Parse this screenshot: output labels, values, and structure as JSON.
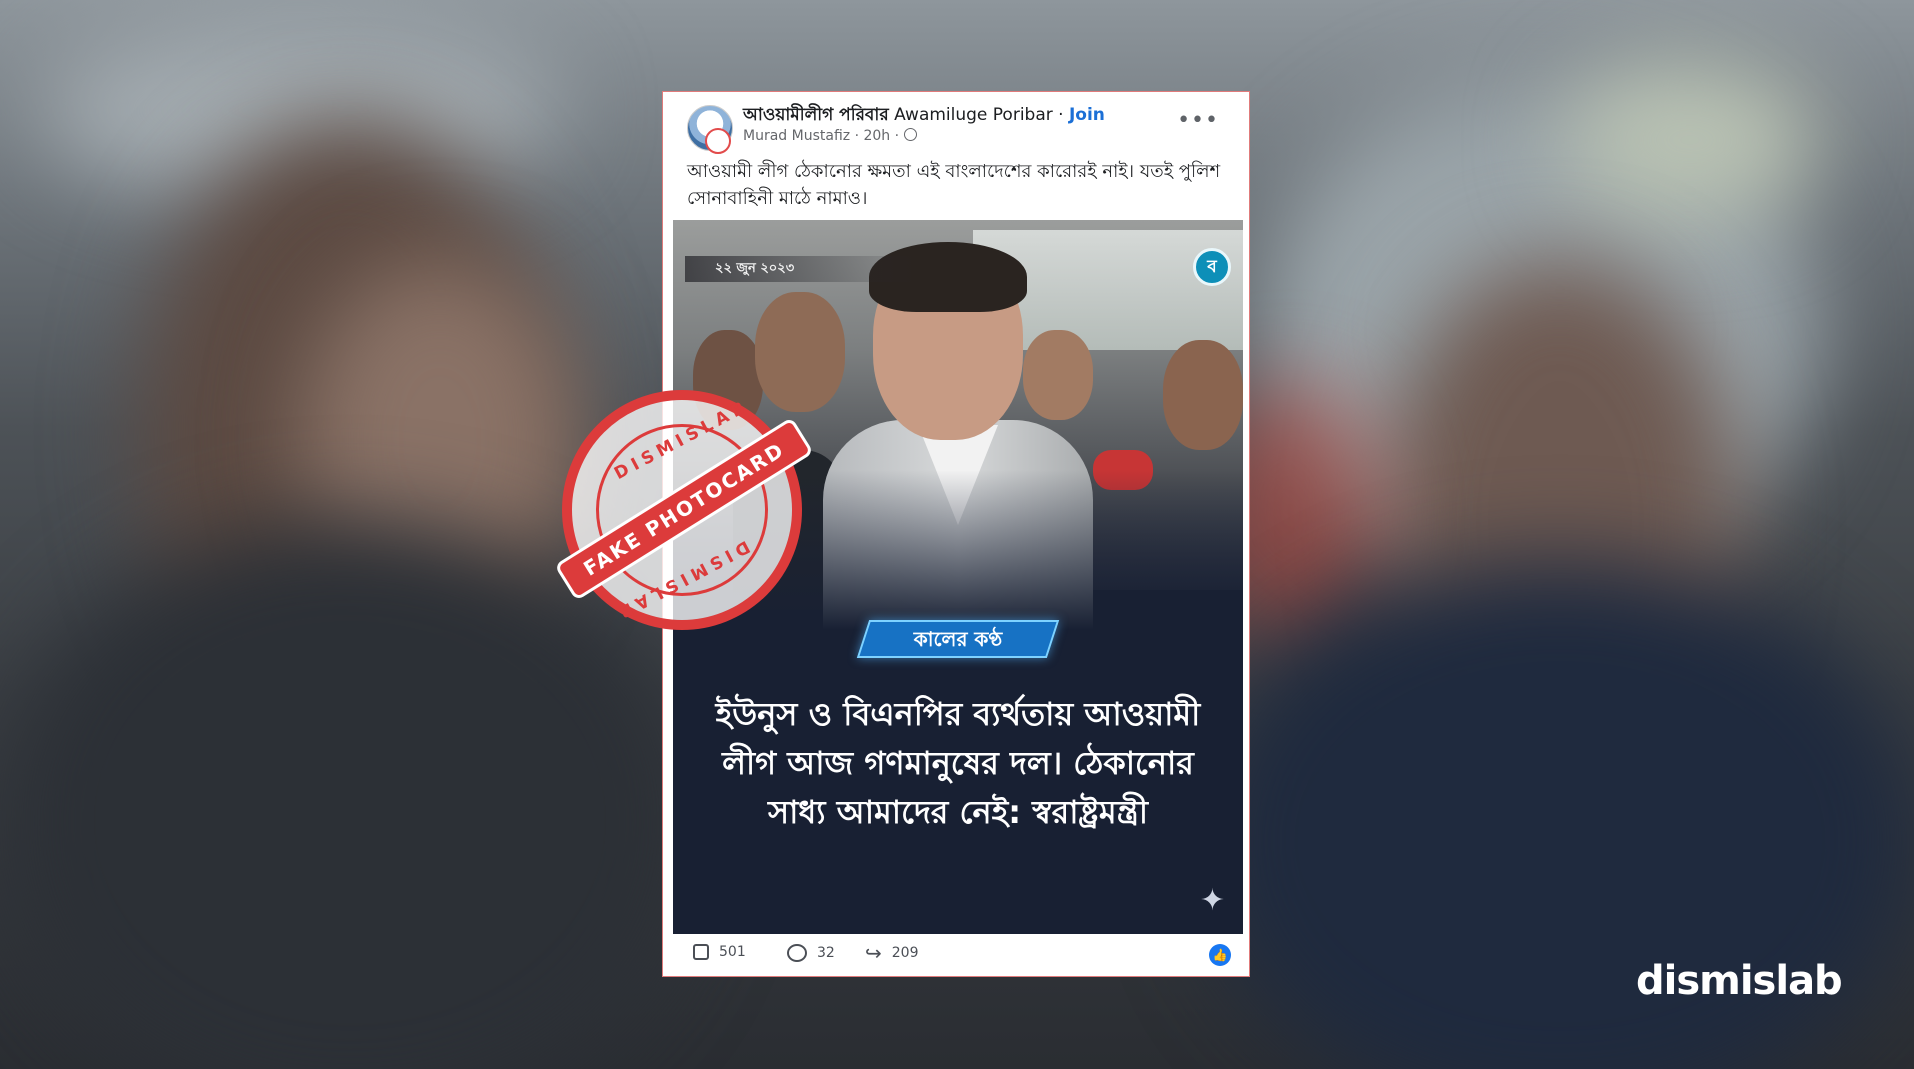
{
  "post": {
    "group_name": "আওয়ামীলীগ পরিবার",
    "group_name_latin": "Awamiluge Poribar",
    "separator": "·",
    "join_label": "Join",
    "author": "Murad Mustafiz",
    "time": "20h",
    "caption": "আওয়ামী লীগ ঠেকানোর ক্ষমতা এই বাংলাদেশের কারোরই নাই। যতই পুলিশ সোনাবাহিনী মাঠে নামাও।",
    "more_icon": "more-dots-icon",
    "privacy_icon": "globe-icon"
  },
  "photocard": {
    "date": "২২ জুন ২০২৩",
    "channel_badge": "কালের কণ্ঠ",
    "corner_logo": "ব",
    "headline": "ইউনুস ও বিএনপির ব্যর্থতায় আওয়ামী লীগ আজ গণমানুষের দল। ঠেকানোর সাধ্য আমাদের নেই: স্বরাষ্ট্রমন্ত্রী"
  },
  "actions": {
    "likes": "501",
    "comments": "32",
    "shares": "209"
  },
  "stamp": {
    "ring_top": "DISMISLAB",
    "ring_bottom": "DISMISLAB",
    "band": "FAKE PHOTOCARD"
  },
  "watermark": "dismislab",
  "colors": {
    "stamp_red": "#dc3b3b",
    "join_blue": "#1b6fd6",
    "badge_blue": "#1772c4",
    "card_bg": "#182033"
  }
}
